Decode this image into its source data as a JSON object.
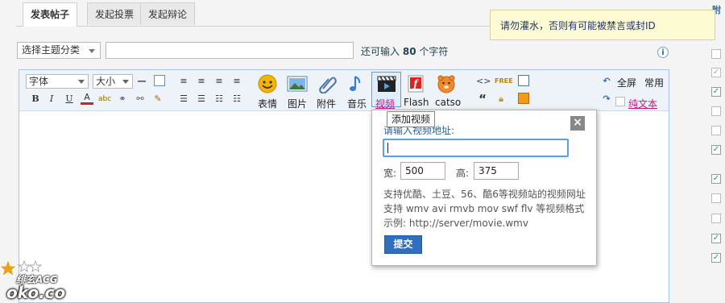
{
  "tabs": [
    {
      "label": "发表帖子",
      "active": true
    },
    {
      "label": "发起投票",
      "active": false
    },
    {
      "label": "发起辩论",
      "active": false
    }
  ],
  "form": {
    "topic_select": "选择主题分类",
    "subject_value": "",
    "remain_prefix": "还可输入",
    "remain_count": "80",
    "remain_suffix": "个字符"
  },
  "tooltip": {
    "text": "请勿灌水，否则有可能被禁言或封ID"
  },
  "cut_link": "附",
  "toolbar": {
    "font_select": "字体",
    "size_select": "大小",
    "emoji": "表情",
    "image": "图片",
    "attachment": "附件",
    "music": "音乐",
    "video": "视频",
    "flash": "Flash",
    "catso": "catso",
    "fullscreen": "全屏",
    "common": "常用",
    "plain_text": "纯文本"
  },
  "hover_tooltip": "添加视频",
  "video_popup": {
    "url_label": "请输入视频地址:",
    "url_value": "",
    "width_label": "宽:",
    "width_value": "500",
    "height_label": "高:",
    "height_value": "375",
    "note_line1": "支持优酷、土豆、56、酷6等视频站的视频网址",
    "note_line2": "支持 wmv avi rmvb mov swf flv 等视频格式",
    "note_line3": "示例: http://server/movie.wmv",
    "submit_label": "提交",
    "close_symbol": "×"
  },
  "watermark": {
    "line1": "绯玄ACG",
    "line2": "oko.co"
  },
  "colors": {
    "accent": "#2f6fbe",
    "tooltip_bg": "#fdfbd3",
    "plain_text": "#c01885"
  }
}
